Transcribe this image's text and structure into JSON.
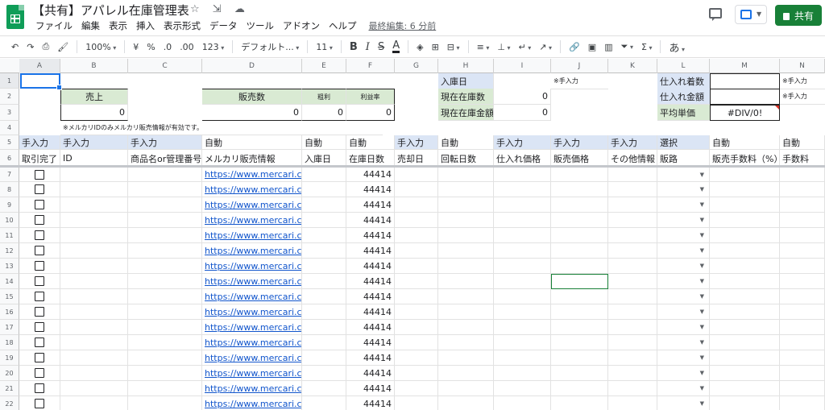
{
  "app": {
    "doc_title": "【共有】アパレル在庫管理表",
    "star_icon": "star-icon",
    "move_icon": "folder-move-icon",
    "cloud_icon": "cloud-status-icon",
    "share_label": "共有",
    "last_edit": "最終編集: 6 分前"
  },
  "menu": [
    "ファイル",
    "編集",
    "表示",
    "挿入",
    "表示形式",
    "データ",
    "ツール",
    "アドオン",
    "ヘルプ"
  ],
  "toolbar": {
    "zoom": "100%",
    "currency": "¥",
    "percent": "%",
    "dec_less": ".0",
    "dec_more": ".00",
    "more_formats": "123",
    "font": "デフォルト...",
    "font_size": "11",
    "bold": "B",
    "italic": "I",
    "strike": "S",
    "text_color": "A",
    "input_tool": "あ"
  },
  "columns": [
    "A",
    "B",
    "C",
    "D",
    "E",
    "F",
    "G",
    "H",
    "I",
    "J",
    "K",
    "L",
    "M",
    "N"
  ],
  "rows": [
    "1",
    "2",
    "3",
    "4",
    "5",
    "6",
    "7",
    "8",
    "9",
    "10",
    "11",
    "12",
    "13",
    "14",
    "15",
    "16",
    "17",
    "18",
    "19",
    "20",
    "21",
    "22"
  ],
  "summary": {
    "sales_label": "売上",
    "sales_value": "0",
    "sold_count_label": "販売数",
    "sold_count_value": "0",
    "gross_profit_label": "粗利",
    "gross_profit_value": "0",
    "profit_rate_label": "利益率",
    "profit_rate_value": "0",
    "arrival_date_label": "入庫日",
    "manual_note_j1": "※手入力",
    "stock_count_label": "現在在庫数",
    "stock_count_value": "0",
    "stock_amount_label": "現在在庫金額",
    "stock_amount_value": "0",
    "purchase_count_label": "仕入れ着数",
    "manual_note_n1": "※手入力",
    "purchase_amount_label": "仕入れ金額",
    "manual_note_n2": "※手入力",
    "avg_price_label": "平均単価",
    "avg_price_value": "#DIV/0!",
    "mercari_note": "※メルカリIDのみメルカリ販売情報が有効です。"
  },
  "row5": [
    "手入力",
    "手入力",
    "手入力",
    "自動",
    "自動",
    "自動",
    "手入力",
    "自動",
    "手入力",
    "手入力",
    "手入力",
    "選択",
    "自動",
    "自動"
  ],
  "row6": [
    "取引完了",
    "ID",
    "商品名or管理番号",
    "メルカリ販売情報",
    "入庫日",
    "在庫日数",
    "売却日",
    "回転日数",
    "仕入れ価格",
    "販売価格",
    "その他情報",
    "販路",
    "販売手数料（%）",
    "手数料"
  ],
  "data_rows": {
    "link_text": "https://www.mercari.com",
    "days_value": "44414"
  }
}
